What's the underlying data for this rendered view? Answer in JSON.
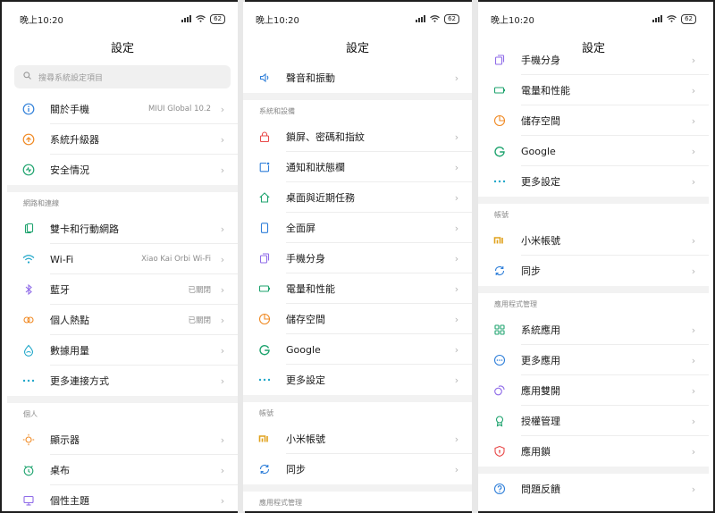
{
  "colors": {
    "blue": "#2f7fd9",
    "orange": "#f08a24",
    "green": "#1ea36e",
    "red": "#e84a4a",
    "purple": "#8f6be8",
    "teal": "#20a7c9",
    "yellow": "#e0a21d"
  },
  "phone1": {
    "time": "晚上10:20",
    "battery": "62",
    "title": "設定",
    "search_placeholder": "搜尋系統設定項目",
    "items_a": [
      {
        "label": "關於手機",
        "value": "MIUI Global 10.2",
        "icon": "info-icon"
      },
      {
        "label": "系統升級器",
        "value": "",
        "icon": "upgrade-icon"
      },
      {
        "label": "安全情況",
        "value": "",
        "icon": "security-icon"
      }
    ],
    "section_network": "網路和連線",
    "items_b": [
      {
        "label": "雙卡和行動網路",
        "value": "",
        "icon": "sim-icon"
      },
      {
        "label": "Wi-Fi",
        "value": "Xiao Kai Orbi Wi-Fi",
        "icon": "wifi-icon"
      },
      {
        "label": "藍牙",
        "value": "已關閉",
        "icon": "bluetooth-icon"
      },
      {
        "label": "個人熱點",
        "value": "已關閉",
        "icon": "hotspot-icon"
      },
      {
        "label": "數據用量",
        "value": "",
        "icon": "data-usage-icon"
      },
      {
        "label": "更多連接方式",
        "value": "",
        "icon": "more-icon"
      }
    ],
    "section_personal": "個人",
    "items_c": [
      {
        "label": "顯示器",
        "value": "",
        "icon": "display-icon"
      },
      {
        "label": "桌布",
        "value": "",
        "icon": "wallpaper-icon"
      },
      {
        "label": "個性主題",
        "value": "",
        "icon": "theme-icon"
      }
    ]
  },
  "phone2": {
    "time": "晚上10:20",
    "battery": "62",
    "title": "設定",
    "items_a": [
      {
        "label": "聲音和振動",
        "icon": "sound-icon"
      }
    ],
    "section_device": "系統和設備",
    "items_b": [
      {
        "label": "鎖屏、密碼和指紋",
        "icon": "lock-icon"
      },
      {
        "label": "通知和狀態欄",
        "icon": "notification-icon"
      },
      {
        "label": "桌面與近期任務",
        "icon": "home-icon"
      },
      {
        "label": "全面屏",
        "icon": "fullscreen-icon"
      },
      {
        "label": "手機分身",
        "icon": "second-space-icon"
      },
      {
        "label": "電量和性能",
        "icon": "battery-icon"
      },
      {
        "label": "儲存空間",
        "icon": "storage-icon"
      },
      {
        "label": "Google",
        "icon": "google-icon"
      },
      {
        "label": "更多設定",
        "icon": "more-icon"
      }
    ],
    "section_account": "帳號",
    "items_c": [
      {
        "label": "小米帳號",
        "icon": "mi-icon"
      },
      {
        "label": "同步",
        "icon": "sync-icon"
      }
    ],
    "section_apps": "應用程式管理"
  },
  "phone3": {
    "time": "晚上10:20",
    "battery": "62",
    "title": "設定",
    "items_a": [
      {
        "label": "手機分身",
        "icon": "second-space-icon"
      },
      {
        "label": "電量和性能",
        "icon": "battery-icon"
      },
      {
        "label": "儲存空間",
        "icon": "storage-icon"
      },
      {
        "label": "Google",
        "icon": "google-icon"
      },
      {
        "label": "更多設定",
        "icon": "more-icon"
      }
    ],
    "section_account": "帳號",
    "items_b": [
      {
        "label": "小米帳號",
        "icon": "mi-icon"
      },
      {
        "label": "同步",
        "icon": "sync-icon"
      }
    ],
    "section_apps": "應用程式管理",
    "items_c": [
      {
        "label": "系統應用",
        "icon": "system-apps-icon"
      },
      {
        "label": "更多應用",
        "icon": "more-apps-icon"
      },
      {
        "label": "應用雙開",
        "icon": "dual-apps-icon"
      },
      {
        "label": "授權管理",
        "icon": "permissions-icon"
      },
      {
        "label": "應用鎖",
        "icon": "app-lock-icon"
      }
    ],
    "items_d": [
      {
        "label": "問題反饋",
        "icon": "feedback-icon"
      }
    ]
  }
}
